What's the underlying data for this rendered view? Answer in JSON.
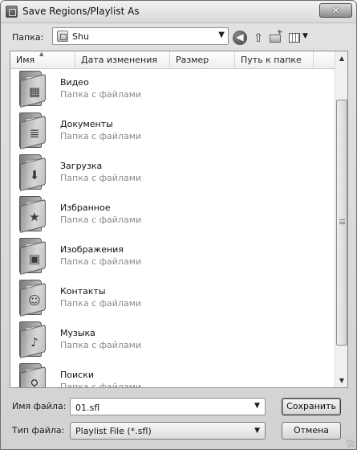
{
  "window": {
    "title": "Save Regions/Playlist As",
    "close_glyph": "✕"
  },
  "location_bar": {
    "label": "Папка:",
    "value": "Shu"
  },
  "toolbar": {
    "back_icon": "back-arrow-icon",
    "up_icon": "up-folder-icon",
    "new_folder_icon": "new-folder-icon",
    "views_icon": "views-menu-icon"
  },
  "file_list": {
    "columns": [
      "Имя",
      "Дата изменения",
      "Размер",
      "Путь к папке"
    ],
    "items": [
      {
        "name": "Видео",
        "type": "Папка с файлами",
        "icon": "video-folder-icon",
        "glyph": "▦"
      },
      {
        "name": "Документы",
        "type": "Папка с файлами",
        "icon": "documents-folder-icon",
        "glyph": "≣"
      },
      {
        "name": "Загрузка",
        "type": "Папка с файлами",
        "icon": "downloads-folder-icon",
        "glyph": "⬇"
      },
      {
        "name": "Избранное",
        "type": "Папка с файлами",
        "icon": "favorites-folder-icon",
        "glyph": "★"
      },
      {
        "name": "Изображения",
        "type": "Папка с файлами",
        "icon": "pictures-folder-icon",
        "glyph": "▣"
      },
      {
        "name": "Контакты",
        "type": "Папка с файлами",
        "icon": "contacts-folder-icon",
        "glyph": "☺"
      },
      {
        "name": "Музыка",
        "type": "Папка с файлами",
        "icon": "music-folder-icon",
        "glyph": "♪"
      },
      {
        "name": "Поиски",
        "type": "Папка с файлами",
        "icon": "searches-folder-icon",
        "glyph": "⚲"
      }
    ]
  },
  "filename": {
    "label": "Имя файла:",
    "value": "01.sfl"
  },
  "filetype": {
    "label": "Тип файла:",
    "value": "Playlist File (*.sfl)"
  },
  "buttons": {
    "save": "Сохранить",
    "cancel": "Отмена"
  }
}
